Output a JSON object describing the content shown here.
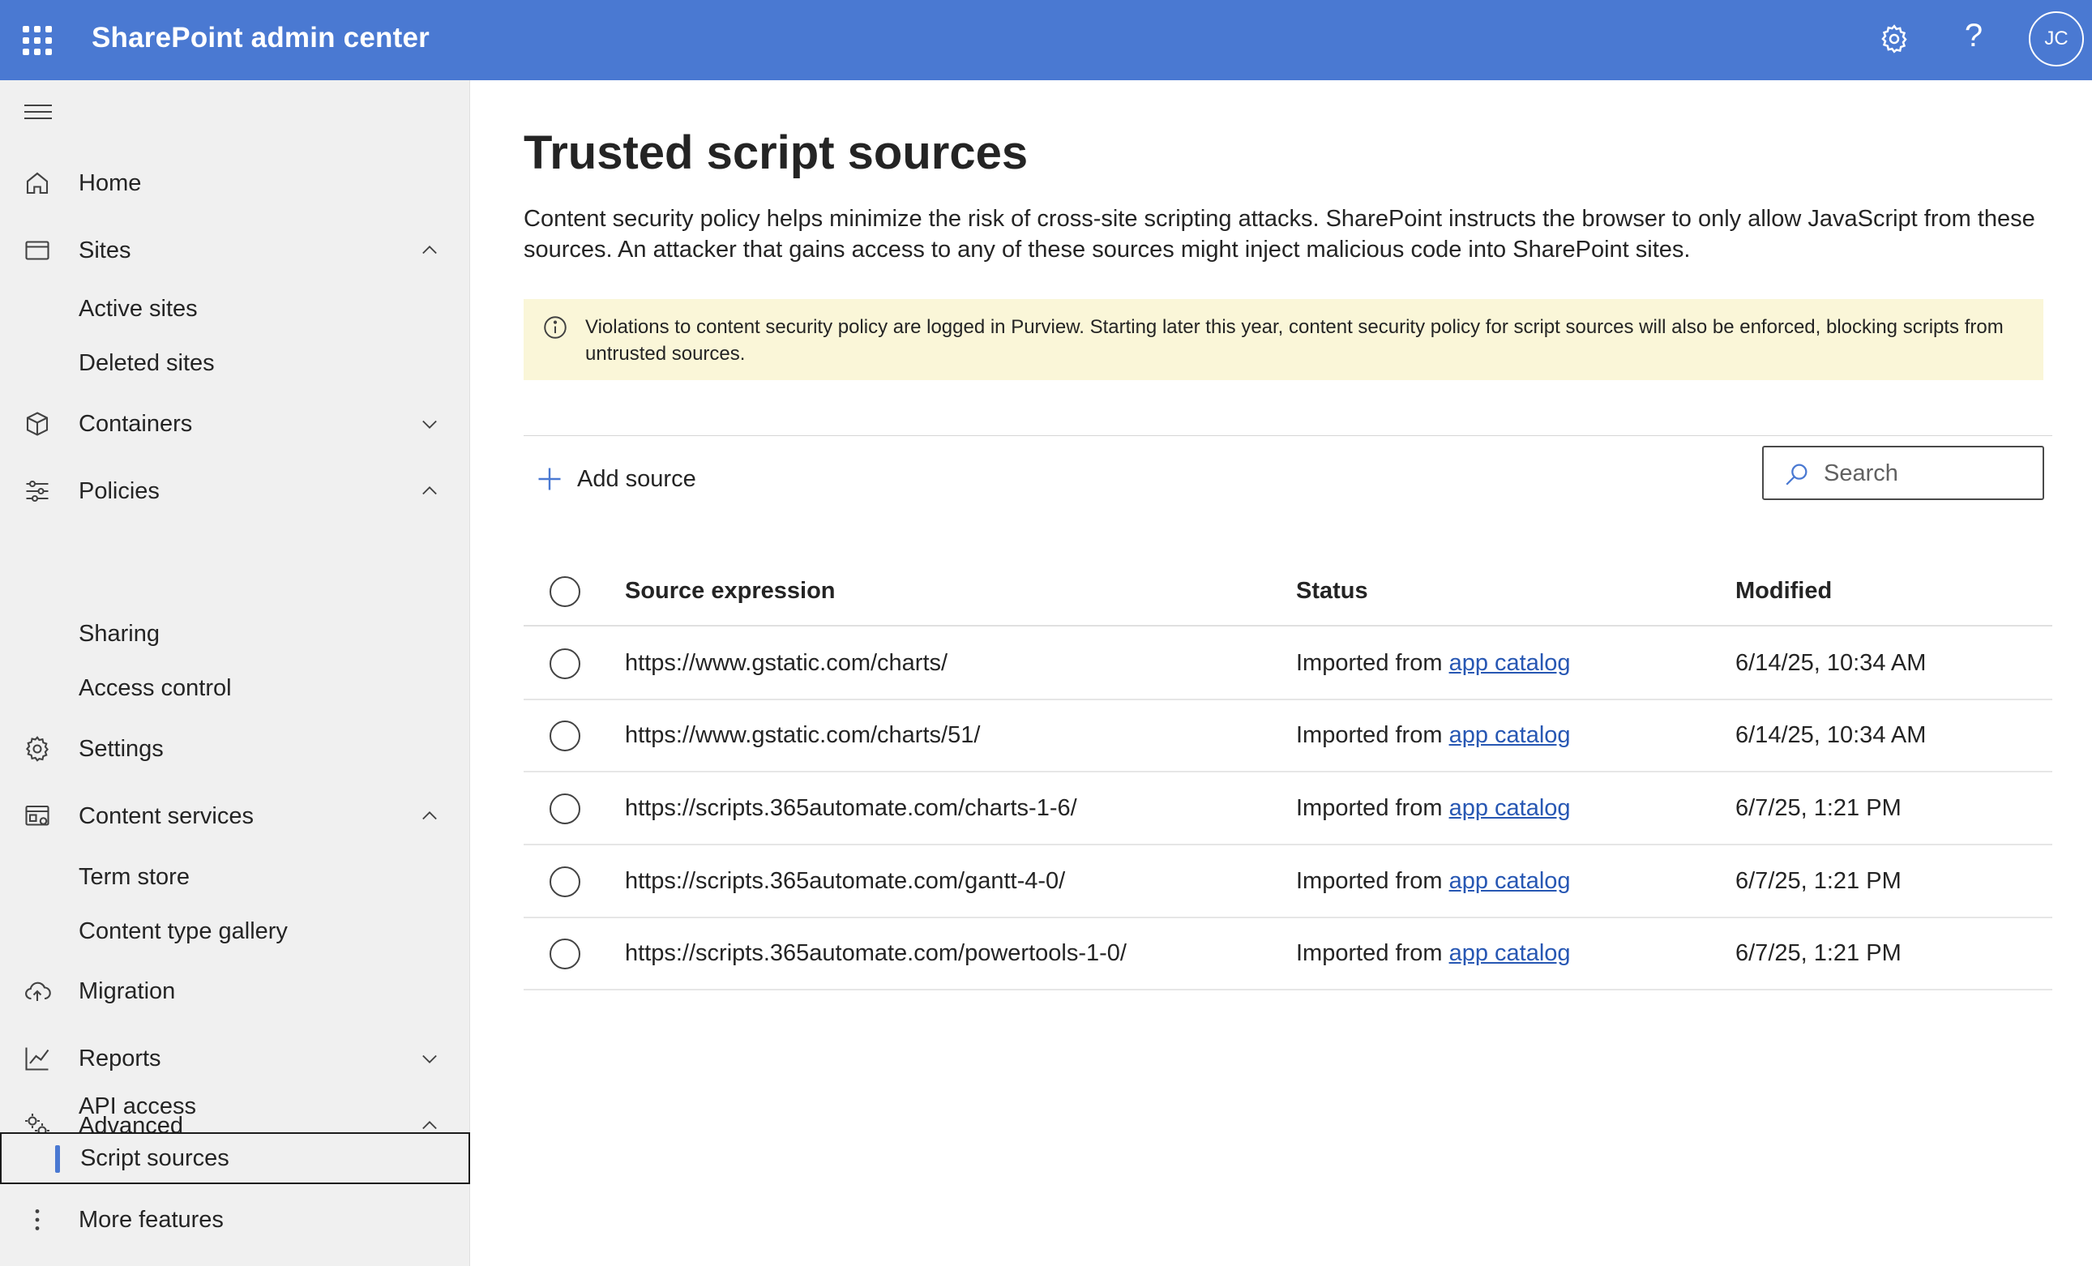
{
  "header": {
    "app_title": "SharePoint admin center",
    "avatar_initials": "JC",
    "help_glyph": "?",
    "brand_color": "#4a79d2"
  },
  "sidebar": {
    "items": [
      {
        "label": "Home",
        "icon": "home-icon"
      },
      {
        "label": "Sites",
        "icon": "sites-icon",
        "expanded": true,
        "children": [
          "Active sites",
          "Deleted sites"
        ]
      },
      {
        "label": "Containers",
        "icon": "containers-icon",
        "expanded": false
      },
      {
        "label": "Policies",
        "icon": "policies-icon",
        "expanded": true,
        "children": [
          "Sharing",
          "Access control"
        ]
      },
      {
        "label": "Settings",
        "icon": "settings-icon"
      },
      {
        "label": "Content services",
        "icon": "content-services-icon",
        "expanded": true,
        "children": [
          "Term store",
          "Content type gallery"
        ]
      },
      {
        "label": "Migration",
        "icon": "migration-icon"
      },
      {
        "label": "Reports",
        "icon": "reports-icon",
        "expanded": false
      },
      {
        "label": "Advanced",
        "icon": "advanced-icon",
        "expanded": true,
        "children": [
          "API access",
          "Script sources"
        ]
      },
      {
        "label": "More features",
        "icon": "more-icon"
      }
    ],
    "selected": "Script sources"
  },
  "main": {
    "title": "Trusted script sources",
    "description": "Content security policy helps minimize the risk of cross-site scripting attacks. SharePoint instructs the browser to only allow JavaScript from these sources. An attacker that gains access to any of these sources might inject malicious code into SharePoint sites.",
    "banner": "Violations to content security policy are logged in Purview. Starting later this year, content security policy for script sources will also be enforced, blocking scripts from untrusted sources.",
    "add_source_label": "Add source",
    "search_placeholder": "Search",
    "table": {
      "columns": [
        "Source expression",
        "Status",
        "Modified"
      ],
      "rows": [
        {
          "source": "https://www.gstatic.com/charts/",
          "status_prefix": "Imported from ",
          "status_link": "app catalog",
          "modified": "6/14/25, 10:34 AM"
        },
        {
          "source": "https://www.gstatic.com/charts/51/",
          "status_prefix": "Imported from ",
          "status_link": "app catalog",
          "modified": "6/14/25, 10:34 AM"
        },
        {
          "source": "https://scripts.365automate.com/charts-1-6/",
          "status_prefix": "Imported from ",
          "status_link": "app catalog",
          "modified": "6/7/25, 1:21 PM"
        },
        {
          "source": "https://scripts.365automate.com/gantt-4-0/",
          "status_prefix": "Imported from ",
          "status_link": "app catalog",
          "modified": "6/7/25, 1:21 PM"
        },
        {
          "source": "https://scripts.365automate.com/powertools-1-0/",
          "status_prefix": "Imported from ",
          "status_link": "app catalog",
          "modified": "6/7/25, 1:21 PM"
        }
      ]
    }
  }
}
